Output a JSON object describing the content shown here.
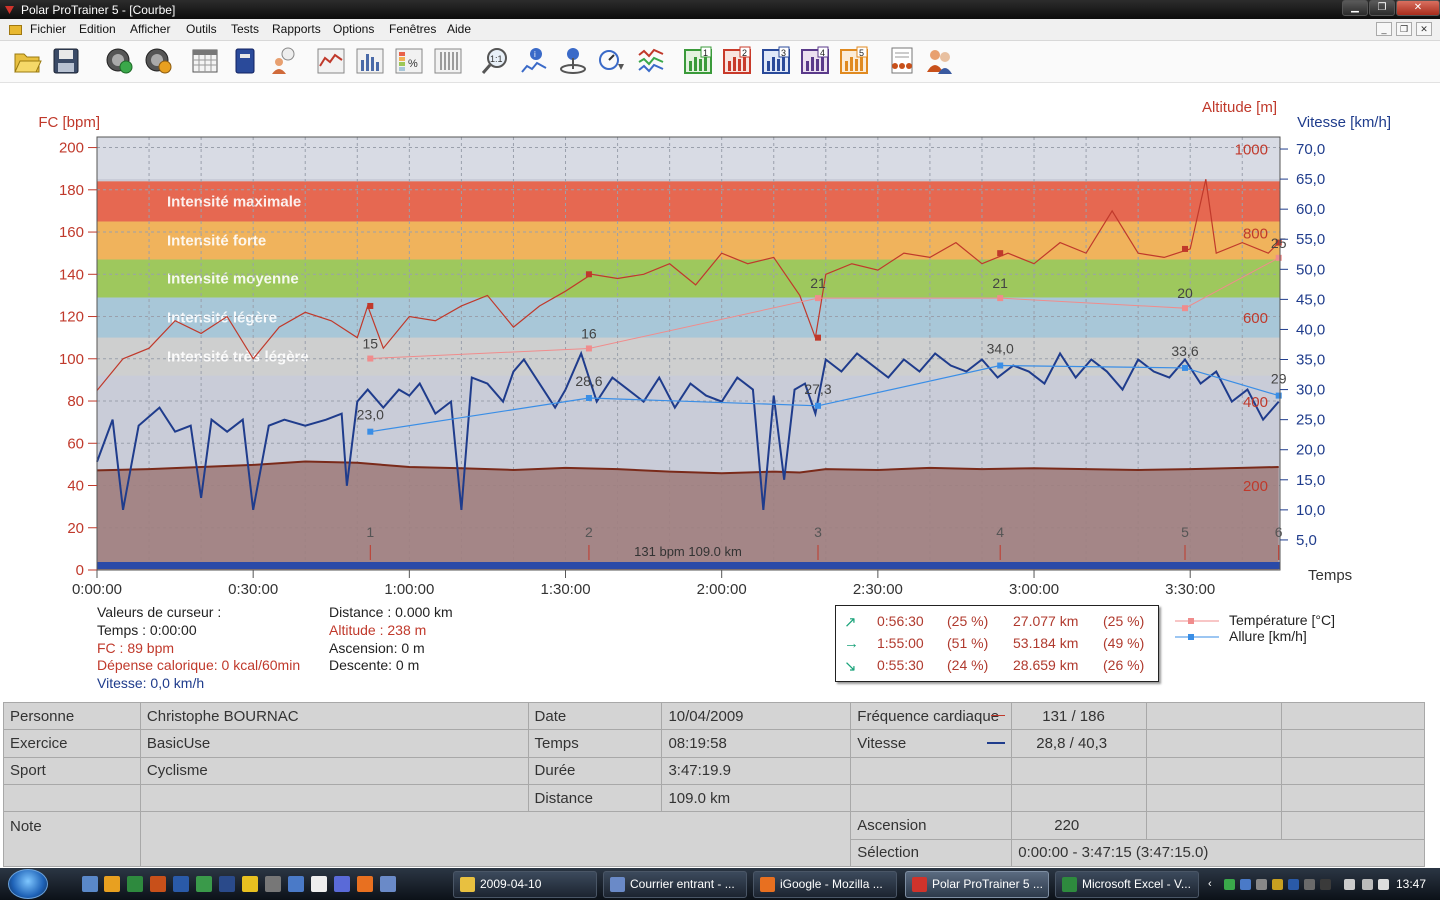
{
  "window": {
    "title": "Polar ProTrainer 5 - [Courbe]"
  },
  "menu": [
    "Fichier",
    "Edition",
    "Afficher",
    "Outils",
    "Tests",
    "Rapports",
    "Options",
    "Fenêtres",
    "Aide"
  ],
  "toolbar": {
    "icons": [
      "open-folder-icon",
      "save-icon",
      "sync-icon",
      "settings-gear-icon",
      "calendar-icon",
      "diary-book-icon",
      "user-info-icon",
      "curve-view-icon",
      "bar-view-icon",
      "percent-view-icon",
      "table-view-icon",
      "zoom-icon",
      "marker-info-icon",
      "lap-icon",
      "speed-sync-icon",
      "multi-curve-icon",
      "zone1-icon",
      "zone2-icon",
      "zone3-icon",
      "zone4-icon",
      "zone5-icon",
      "report-icon",
      "users-icon"
    ],
    "badges": [
      "1:1",
      "1",
      "2",
      "3",
      "4",
      "5"
    ]
  },
  "chart_data": {
    "type": "line",
    "y_left_label": "FC [bpm]",
    "y_left_ticks": [
      "0",
      "20",
      "40",
      "60",
      "80",
      "100",
      "120",
      "140",
      "160",
      "180",
      "200"
    ],
    "y_right_altitude_label": "Altitude  [m]",
    "y_right_altitude_ticks": [
      "200",
      "400",
      "600",
      "800",
      "1000"
    ],
    "y_right_speed_label": "Vitesse [km/h]",
    "y_right_speed_ticks": [
      "5,0",
      "10,0",
      "15,0",
      "20,0",
      "25,0",
      "30,0",
      "35,0",
      "40,0",
      "45,0",
      "50,0",
      "55,0",
      "60,0",
      "65,0",
      "70,0"
    ],
    "x_label": "Temps",
    "x_ticks": [
      "0:00:00",
      "0:30:00",
      "1:00:00",
      "1:30:00",
      "2:00:00",
      "2:30:00",
      "3:00:00",
      "3:30:00"
    ],
    "xlim_minutes": [
      0,
      227.25
    ],
    "zones": [
      {
        "name": "Intensité maximale",
        "from": 165,
        "to": 184,
        "color": "#e8624a"
      },
      {
        "name": "Intensité forte",
        "from": 147,
        "to": 165,
        "color": "#f2b155"
      },
      {
        "name": "Intensité moyenne",
        "from": 129,
        "to": 147,
        "color": "#9cc756"
      },
      {
        "name": "Intensité légère",
        "from": 110,
        "to": 129,
        "color": "#a7c6d8"
      },
      {
        "name": "Intensité très légère",
        "from": 92,
        "to": 110,
        "color": "#cfcfcf"
      }
    ],
    "series": [
      {
        "name": "FC",
        "color": "#c0392b",
        "points": [
          [
            0,
            85
          ],
          [
            5,
            100
          ],
          [
            10,
            105
          ],
          [
            15,
            118
          ],
          [
            20,
            112
          ],
          [
            25,
            120
          ],
          [
            30,
            100
          ],
          [
            35,
            115
          ],
          [
            40,
            122
          ],
          [
            45,
            118
          ],
          [
            50,
            110
          ],
          [
            52,
            125
          ],
          [
            55,
            105
          ],
          [
            60,
            120
          ],
          [
            65,
            118
          ],
          [
            70,
            125
          ],
          [
            75,
            130
          ],
          [
            80,
            115
          ],
          [
            85,
            125
          ],
          [
            90,
            132
          ],
          [
            95,
            140
          ],
          [
            100,
            138
          ],
          [
            105,
            140
          ],
          [
            110,
            145
          ],
          [
            115,
            135
          ],
          [
            120,
            150
          ],
          [
            125,
            145
          ],
          [
            130,
            148
          ],
          [
            135,
            130
          ],
          [
            138,
            110
          ],
          [
            140,
            140
          ],
          [
            145,
            145
          ],
          [
            150,
            142
          ],
          [
            155,
            150
          ],
          [
            160,
            148
          ],
          [
            165,
            155
          ],
          [
            170,
            145
          ],
          [
            175,
            150
          ],
          [
            180,
            145
          ],
          [
            185,
            155
          ],
          [
            190,
            150
          ],
          [
            195,
            170
          ],
          [
            200,
            150
          ],
          [
            205,
            148
          ],
          [
            210,
            152
          ],
          [
            213,
            185
          ],
          [
            215,
            150
          ],
          [
            220,
            155
          ],
          [
            225,
            150
          ],
          [
            227,
            155
          ]
        ]
      },
      {
        "name": "Vitesse",
        "color": "#1f3c8c",
        "points": [
          [
            0,
            18
          ],
          [
            3,
            25
          ],
          [
            5,
            10
          ],
          [
            8,
            24
          ],
          [
            12,
            27
          ],
          [
            15,
            23
          ],
          [
            18,
            24
          ],
          [
            20,
            12
          ],
          [
            22,
            25
          ],
          [
            25,
            23
          ],
          [
            28,
            25
          ],
          [
            30,
            10
          ],
          [
            33,
            24
          ],
          [
            36,
            25
          ],
          [
            40,
            24
          ],
          [
            44,
            25
          ],
          [
            47,
            26
          ],
          [
            48,
            14
          ],
          [
            50,
            28
          ],
          [
            52,
            30
          ],
          [
            55,
            27
          ],
          [
            58,
            30
          ],
          [
            60,
            29
          ],
          [
            62,
            31
          ],
          [
            65,
            26
          ],
          [
            68,
            28
          ],
          [
            70,
            10
          ],
          [
            72,
            32
          ],
          [
            75,
            31
          ],
          [
            78,
            28
          ],
          [
            80,
            33
          ],
          [
            82,
            35
          ],
          [
            85,
            31
          ],
          [
            88,
            27
          ],
          [
            90,
            30
          ],
          [
            93,
            36
          ],
          [
            96,
            28
          ],
          [
            99,
            32
          ],
          [
            102,
            30
          ],
          [
            105,
            28
          ],
          [
            108,
            32
          ],
          [
            111,
            27
          ],
          [
            114,
            31
          ],
          [
            117,
            29
          ],
          [
            120,
            28
          ],
          [
            123,
            32
          ],
          [
            126,
            30
          ],
          [
            128,
            10
          ],
          [
            130,
            29
          ],
          [
            132,
            15
          ],
          [
            134,
            30
          ],
          [
            136,
            31
          ],
          [
            138,
            26
          ],
          [
            140,
            35
          ],
          [
            143,
            33
          ],
          [
            146,
            36
          ],
          [
            149,
            34
          ],
          [
            152,
            32
          ],
          [
            155,
            35
          ],
          [
            158,
            33
          ],
          [
            161,
            36
          ],
          [
            164,
            34
          ],
          [
            167,
            33
          ],
          [
            170,
            35
          ],
          [
            173,
            32
          ],
          [
            176,
            34
          ],
          [
            179,
            33
          ],
          [
            182,
            31
          ],
          [
            185,
            36
          ],
          [
            188,
            32
          ],
          [
            191,
            35
          ],
          [
            194,
            33
          ],
          [
            197,
            30
          ],
          [
            200,
            35
          ],
          [
            203,
            33
          ],
          [
            206,
            32
          ],
          [
            209,
            35
          ],
          [
            212,
            31
          ],
          [
            215,
            33
          ],
          [
            218,
            28
          ],
          [
            221,
            30
          ],
          [
            224,
            25
          ],
          [
            227,
            28
          ]
        ]
      },
      {
        "name": "Altitude",
        "color": "#7a2a1a",
        "points": [
          [
            0,
            237
          ],
          [
            10,
            240
          ],
          [
            20,
            245
          ],
          [
            30,
            250
          ],
          [
            40,
            258
          ],
          [
            50,
            255
          ],
          [
            60,
            245
          ],
          [
            70,
            242
          ],
          [
            80,
            238
          ],
          [
            90,
            243
          ],
          [
            100,
            240
          ],
          [
            110,
            234
          ],
          [
            120,
            230
          ],
          [
            130,
            234
          ],
          [
            135,
            232
          ],
          [
            140,
            240
          ],
          [
            150,
            238
          ],
          [
            160,
            243
          ],
          [
            170,
            240
          ],
          [
            180,
            242
          ],
          [
            190,
            240
          ],
          [
            200,
            238
          ],
          [
            210,
            240
          ],
          [
            220,
            243
          ],
          [
            227,
            245
          ]
        ]
      }
    ],
    "temperature": {
      "name": "Température [°C]",
      "color": "#f08c8c",
      "points": [
        {
          "t": 52.5,
          "v": 15,
          "label": "15"
        },
        {
          "t": 94.5,
          "v": 16,
          "label": "16"
        },
        {
          "t": 138.5,
          "v": 21,
          "label": "21"
        },
        {
          "t": 173.5,
          "v": 21,
          "label": "21"
        },
        {
          "t": 209,
          "v": 20,
          "label": "20"
        },
        {
          "t": 227,
          "v": 25,
          "label": "25"
        }
      ]
    },
    "allure": {
      "name": "Allure [km/h]",
      "color": "#3a8ee6",
      "points": [
        {
          "t": 52.5,
          "v": 23.0,
          "label": "23,0"
        },
        {
          "t": 94.5,
          "v": 28.6,
          "label": "28,6"
        },
        {
          "t": 138.5,
          "v": 27.3,
          "label": "27,3"
        },
        {
          "t": 173.5,
          "v": 34.0,
          "label": "34,0"
        },
        {
          "t": 209,
          "v": 33.6,
          "label": "33,6"
        },
        {
          "t": 227,
          "v": 29.0,
          "label": "29"
        }
      ]
    },
    "laps": [
      {
        "t": 52.5,
        "label": "1"
      },
      {
        "t": 94.5,
        "label": "2"
      },
      {
        "t": 138.5,
        "label": "3"
      },
      {
        "t": 173.5,
        "label": "4"
      },
      {
        "t": 209,
        "label": "5"
      },
      {
        "t": 227,
        "label": "6"
      }
    ],
    "bottom_note": "131 bpm 109.0 km"
  },
  "cursor_values": {
    "heading": "Valeurs de curseur :",
    "temps": "Temps : 0:00:00",
    "fc": "FC : 89 bpm",
    "depense": "Dépense calorique: 0 kcal/60min",
    "vitesse": "Vitesse: 0,0 km/h",
    "distance": "Distance : 0.000 km",
    "altitude": "Altitude : 238 m",
    "ascension": "Ascension: 0 m",
    "descente": "Descente: 0 m"
  },
  "summary": [
    {
      "time": "0:56:30",
      "pct1": "(25 %)",
      "dist": "27.077 km",
      "pct2": "(25 %)"
    },
    {
      "time": "1:55:00",
      "pct1": "(51 %)",
      "dist": "53.184 km",
      "pct2": "(49 %)"
    },
    {
      "time": "0:55:30",
      "pct1": "(24 %)",
      "dist": "28.659 km",
      "pct2": "(26 %)"
    }
  ],
  "legend": [
    "Température [°C]",
    "Allure [km/h]"
  ],
  "table": {
    "personne_label": "Personne",
    "personne": "Christophe BOURNAC",
    "exercice_label": "Exercice",
    "exercice": "BasicUse",
    "sport_label": "Sport",
    "sport": "Cyclisme",
    "note_label": "Note",
    "date_label": "Date",
    "date": "10/04/2009",
    "temps_label": "Temps",
    "temps": "08:19:58",
    "duree_label": "Durée",
    "duree": "3:47:19.9",
    "distance_label": "Distance",
    "distance": "109.0 km",
    "fc_label": "Fréquence cardiaque",
    "fc": "131 / 186",
    "vitesse_label": "Vitesse",
    "vitesse": "28,8 / 40,3",
    "ascension_label": "Ascension",
    "ascension": "220",
    "selection_label": "Sélection",
    "selection": "0:00:00 - 3:47:15 (3:47:15.0)"
  },
  "taskbar": {
    "tasks": [
      "2009-04-10",
      "Courrier entrant - ...",
      "iGoogle - Mozilla ...",
      "Polar ProTrainer 5 ...",
      "Microsoft Excel - V..."
    ],
    "clock": "13:47"
  }
}
